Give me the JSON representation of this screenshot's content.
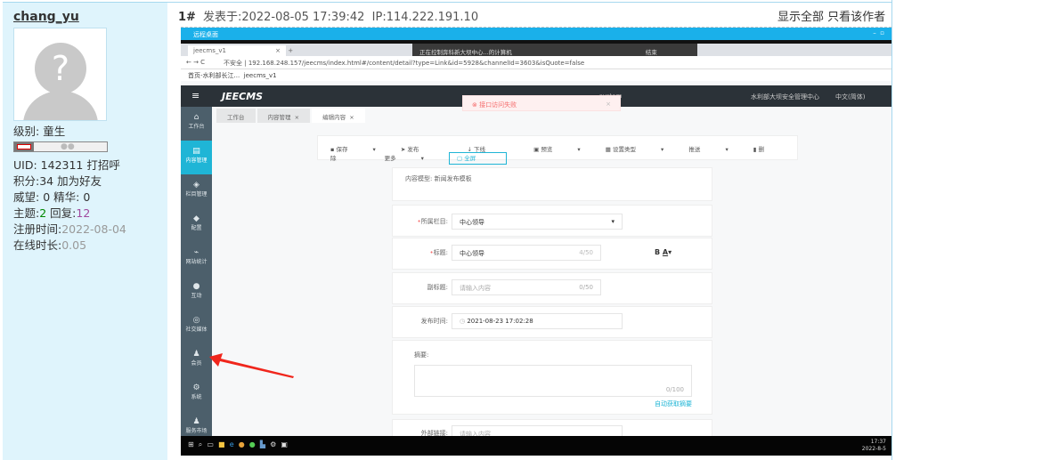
{
  "user": {
    "name": "chang_yu",
    "level_label": "级别:",
    "level": "童生",
    "uid_label": "UID:",
    "uid": "142311",
    "greet": "打招呼",
    "points_label": "积分:",
    "points": "34",
    "add_friend": "加为好友",
    "prestige_label": "威望:",
    "prestige": "0",
    "essence_label": "精华:",
    "essence": "0",
    "topics_label": "主题:",
    "topics": "2",
    "replies_label": "回复:",
    "replies": "12",
    "reg_label": "注册时间:",
    "reg": "2022-08-04",
    "online_label": "在线时长:",
    "online": "0.05"
  },
  "post": {
    "floor": "1#",
    "posted": "发表于:2022-08-05 17:39:42",
    "ip": "IP:114.222.191.10",
    "show_all": "显示全部",
    "only_author": "只看该作者"
  },
  "shot": {
    "rd_title": "远程桌面",
    "tab": "jeecms_v1",
    "remote_bar": "正在控制奔科新大坝中心...的计算机",
    "remote_end": "结束",
    "insecure": "不安全",
    "url": "192.168.248.157/jeecms/index.html#/content/detail?type=Link&id=5928&channelId=3603&isQuote=false",
    "bookmarks": [
      "首页-水利部长江...",
      "jeecms_v1"
    ],
    "logo": "JEECMS",
    "header_right": [
      "system",
      "水利部大坝安全管理中心",
      "中文(简体)"
    ],
    "error": "接口访问失败",
    "nav": [
      "工作台",
      "内容管理",
      "栏目管理",
      "配置",
      "网站统计",
      "互动",
      "社交媒体",
      "会员",
      "系统",
      "服务市场"
    ],
    "tabs": [
      "工作台",
      "内容管理",
      "编辑内容"
    ],
    "toolbar": [
      "保存",
      "发布",
      "下线",
      "预览",
      "设置类型",
      "推送",
      "删除",
      "更多",
      "全屏"
    ],
    "model_label": "内容模型:",
    "model": "新闻发布模板",
    "column_label": "所属栏目:",
    "column": "中心领导",
    "title_label": "标题:",
    "title": "中心领导",
    "title_count": "4/50",
    "subtitle_label": "副标题:",
    "subtitle_ph": "请输入内容",
    "subtitle_count": "0/50",
    "time_label": "发布时间:",
    "time": "2021-08-23 17:02:28",
    "summary_label": "摘要:",
    "summary_count": "0/100",
    "auto_summary": "自动获取摘要",
    "link_label": "外部链接:",
    "link_ph": "请输入内容",
    "clock": "17:37",
    "date": "2022-8-5"
  }
}
